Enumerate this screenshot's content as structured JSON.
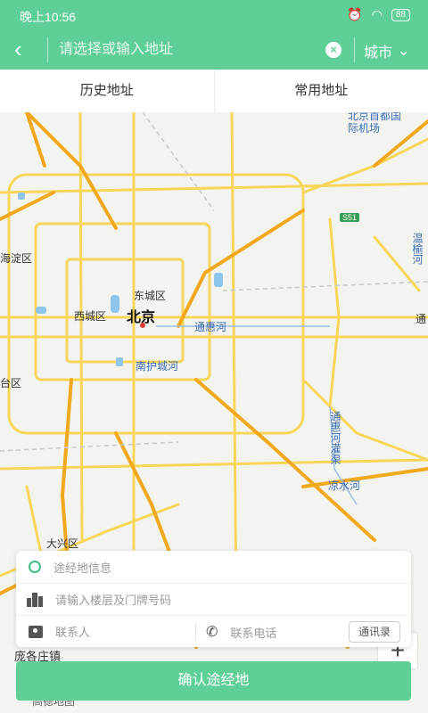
{
  "status": {
    "time": "晚上10:56",
    "battery": "88",
    "icons": [
      "alarm-icon",
      "wifi-icon",
      "battery-icon"
    ]
  },
  "search": {
    "placeholder": "请选择或输入地址",
    "city_label": "城市"
  },
  "tabs": [
    {
      "label": "历史地址"
    },
    {
      "label": "常用地址"
    }
  ],
  "map": {
    "labels": {
      "beijing": "北京",
      "dongcheng": "东城区",
      "xicheng": "西城区",
      "haidian": "海淀区",
      "fengtai": "台区",
      "daxing": "大兴区",
      "tonghuihe": "通惠河",
      "nanhucheng": "南护城河",
      "liangshui": "凉水河",
      "tonghui_guanqu": "通惠河灌渠",
      "wenyu": "温榆河",
      "tong": "通",
      "airport": "北京首都国际机场",
      "pangezhuang": "庞各庄镇",
      "gaode": "高德地图"
    },
    "badge": "S51"
  },
  "card": {
    "waypoint_placeholder": "途经地信息",
    "floor_placeholder": "请输入楼层及门牌号码",
    "contact_placeholder": "联系人",
    "phone_placeholder": "联系电话",
    "contacts_button": "通讯录"
  },
  "confirm_label": "确认途经地",
  "colors": {
    "accent": "#5fcf98",
    "road_major": "#f0a81c",
    "road_minor": "#f7d65a"
  }
}
